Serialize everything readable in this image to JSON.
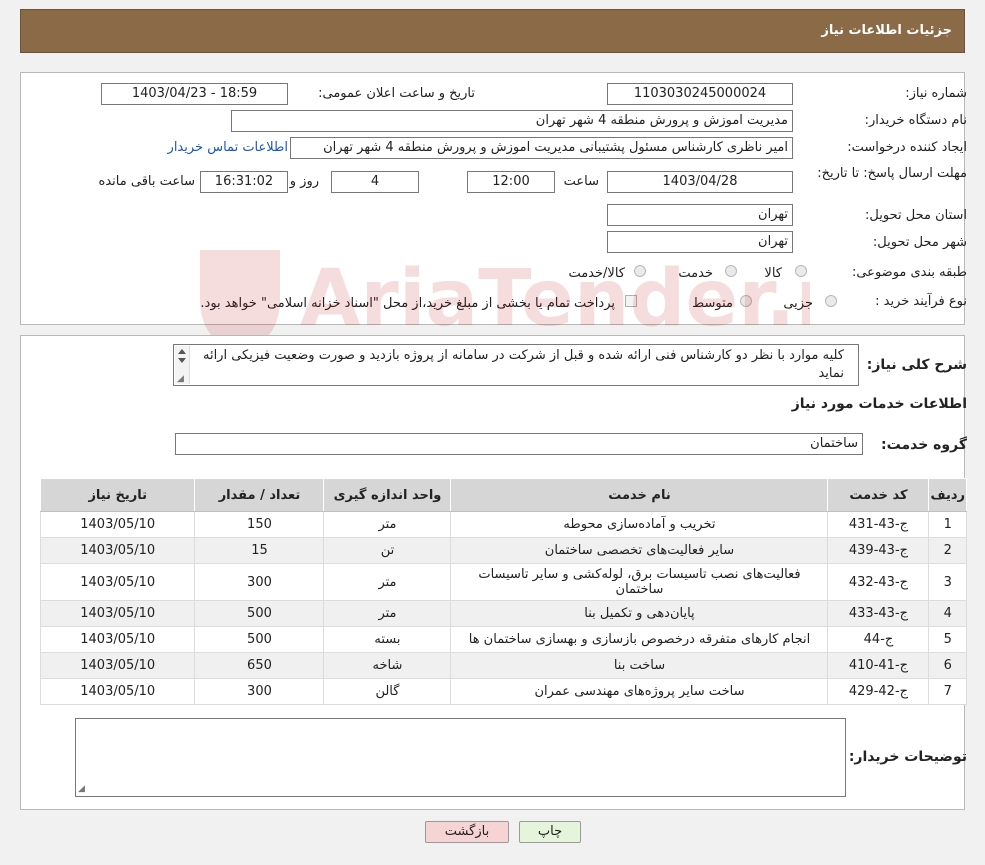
{
  "header": {
    "title": "جزئیات اطلاعات نیاز"
  },
  "form": {
    "need_number_label": "شماره نیاز:",
    "need_number": "1103030245000024",
    "announce_label": "تاریخ و ساعت اعلان عمومی:",
    "announce_value": "1403/04/23 - 18:59",
    "buyer_org_label": "نام دستگاه خریدار:",
    "buyer_org": "مدیریت اموزش و پرورش منطقه 4 شهر تهران",
    "creator_label": "ایجاد کننده درخواست:",
    "creator": "امیر ناظری کارشناس مسئول پشتیبانی  مدیریت اموزش و پرورش منطقه 4 شهر تهران",
    "contact_link": "اطلاعات تماس خریدار",
    "deadline_label": "مهلت ارسال پاسخ: تا تاریخ:",
    "deadline_date": "1403/04/28",
    "time_label": "ساعت",
    "deadline_time": "12:00",
    "days_value": "4",
    "days_label": "روز و",
    "remaining_time": "16:31:02",
    "remaining_label": "ساعت باقی مانده",
    "province_label": "استان محل تحویل:",
    "province": "تهران",
    "city_label": "شهر محل تحویل:",
    "city": "تهران",
    "category_label": "طبقه بندی موضوعی:",
    "category_options": [
      "کالا",
      "خدمت",
      "کالا/خدمت"
    ],
    "process_label": "نوع فرآیند خرید :",
    "process_options": [
      "جزیی",
      "متوسط"
    ],
    "payment_note": "پرداخت تمام یا بخشی از مبلغ خرید،از محل \"اسناد خزانه اسلامی\" خواهد بود."
  },
  "summary": {
    "label": "شرح کلی نیاز:",
    "text": "کلیه موارد با نظر دو کارشناس فنی ارائه شده و قبل از شرکت در سامانه از پروژه بازدید و صورت وضعیت فیزیکی ارائه نماید"
  },
  "services": {
    "section_title": "اطلاعات خدمات مورد نیاز",
    "group_label": "گروه خدمت:",
    "group_value": "ساختمان",
    "columns": [
      "ردیف",
      "کد خدمت",
      "نام خدمت",
      "واحد اندازه گیری",
      "تعداد / مقدار",
      "تاریخ نیاز"
    ],
    "rows": [
      {
        "idx": "1",
        "code": "ج-43-431",
        "name": "تخریب و آماده‌سازی محوطه",
        "unit": "متر",
        "qty": "150",
        "date": "1403/05/10"
      },
      {
        "idx": "2",
        "code": "ج-43-439",
        "name": "سایر فعالیت‌های تخصصی ساختمان",
        "unit": "تن",
        "qty": "15",
        "date": "1403/05/10"
      },
      {
        "idx": "3",
        "code": "ج-43-432",
        "name": "فعالیت‌های نصب تاسیسات برق، لوله‌کشی و سایر تاسیسات ساختمان",
        "unit": "متر",
        "qty": "300",
        "date": "1403/05/10"
      },
      {
        "idx": "4",
        "code": "ج-43-433",
        "name": "پایان‌دهی و تکمیل بنا",
        "unit": "متر",
        "qty": "500",
        "date": "1403/05/10"
      },
      {
        "idx": "5",
        "code": "ج-44",
        "name": "انجام کارهای متفرقه درخصوص بازسازی و بهسازی ساختمان ها",
        "unit": "بسته",
        "qty": "500",
        "date": "1403/05/10"
      },
      {
        "idx": "6",
        "code": "ج-41-410",
        "name": "ساخت بنا",
        "unit": "شاخه",
        "qty": "650",
        "date": "1403/05/10"
      },
      {
        "idx": "7",
        "code": "ج-42-429",
        "name": "ساخت سایر پروژه‌های مهندسی عمران",
        "unit": "گالن",
        "qty": "300",
        "date": "1403/05/10"
      }
    ]
  },
  "buyer_notes": {
    "label": "توضیحات خریدار:",
    "value": ""
  },
  "buttons": {
    "print": "چاپ",
    "back": "بازگشت"
  },
  "watermark": {
    "text": "AriaTender.neT"
  },
  "colors": {
    "header_bg": "#8a6a47",
    "back_button": "#f7d4d4",
    "print_button": "#e4f5dc",
    "link": "#1a56c4"
  }
}
